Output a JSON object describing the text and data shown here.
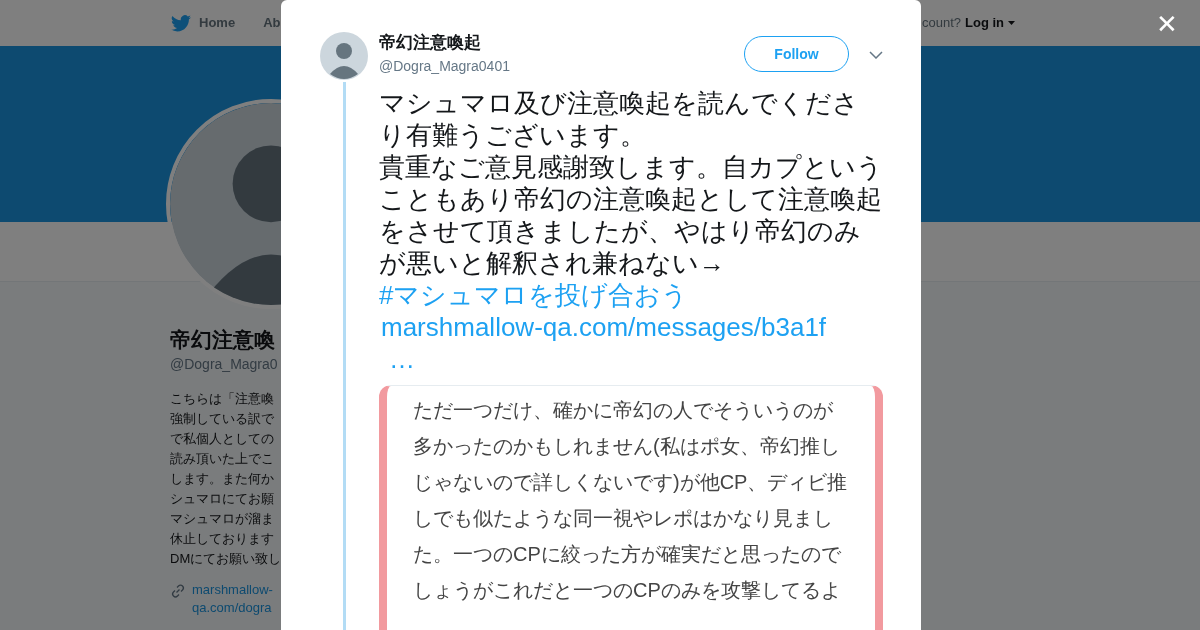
{
  "nav": {
    "items": [
      "Home",
      "Ab"
    ],
    "account_prompt": "count?",
    "login": "Log in"
  },
  "profile": {
    "name": "帝幻注意喚",
    "handle": "@Dogra_Magra0",
    "bio_lines": [
      "こちらは「注意喚",
      "強制している訳で",
      "で私個人としての",
      "読み頂いた上でこ",
      "します。また何か",
      "シュマロにてお願",
      "マシュマロが溜ま",
      "休止しております",
      "DMにてお願い致し"
    ],
    "link_lines": [
      "marshmallow-",
      "qa.com/dogra"
    ]
  },
  "tweet": {
    "author": "帝幻注意喚起",
    "handle": "@Dogra_Magra0401",
    "follow": "Follow",
    "paragraphs": [
      "マシュマロ及び注意喚起を読んでくださり有難うございます。",
      "貴重なご意見感謝致します。自カプということもあり帝幻の注意喚起として注意喚起をさせて頂きましたが、やはり帝幻のみが悪いと解釈され兼ねない→"
    ],
    "hashtag": "#マシュマロを投げ合おう",
    "link": "marshmallow-qa.com/messages/b3a1f",
    "ellipsis": "…",
    "card_lines": [
      "ただ一つだけ、確かに帝幻の人でそういうのが",
      "多かったのかもしれません(私はポ女、帝幻推し",
      "じゃないので詳しくないです)が他CP、ディビ推",
      "しでも似たような同一視やレポはかなり見まし",
      "た。一つのCPに絞った方が確実だと思ったので",
      "しょうがこれだと一つのCPのみを攻撃してるよ"
    ]
  },
  "close": "✕"
}
